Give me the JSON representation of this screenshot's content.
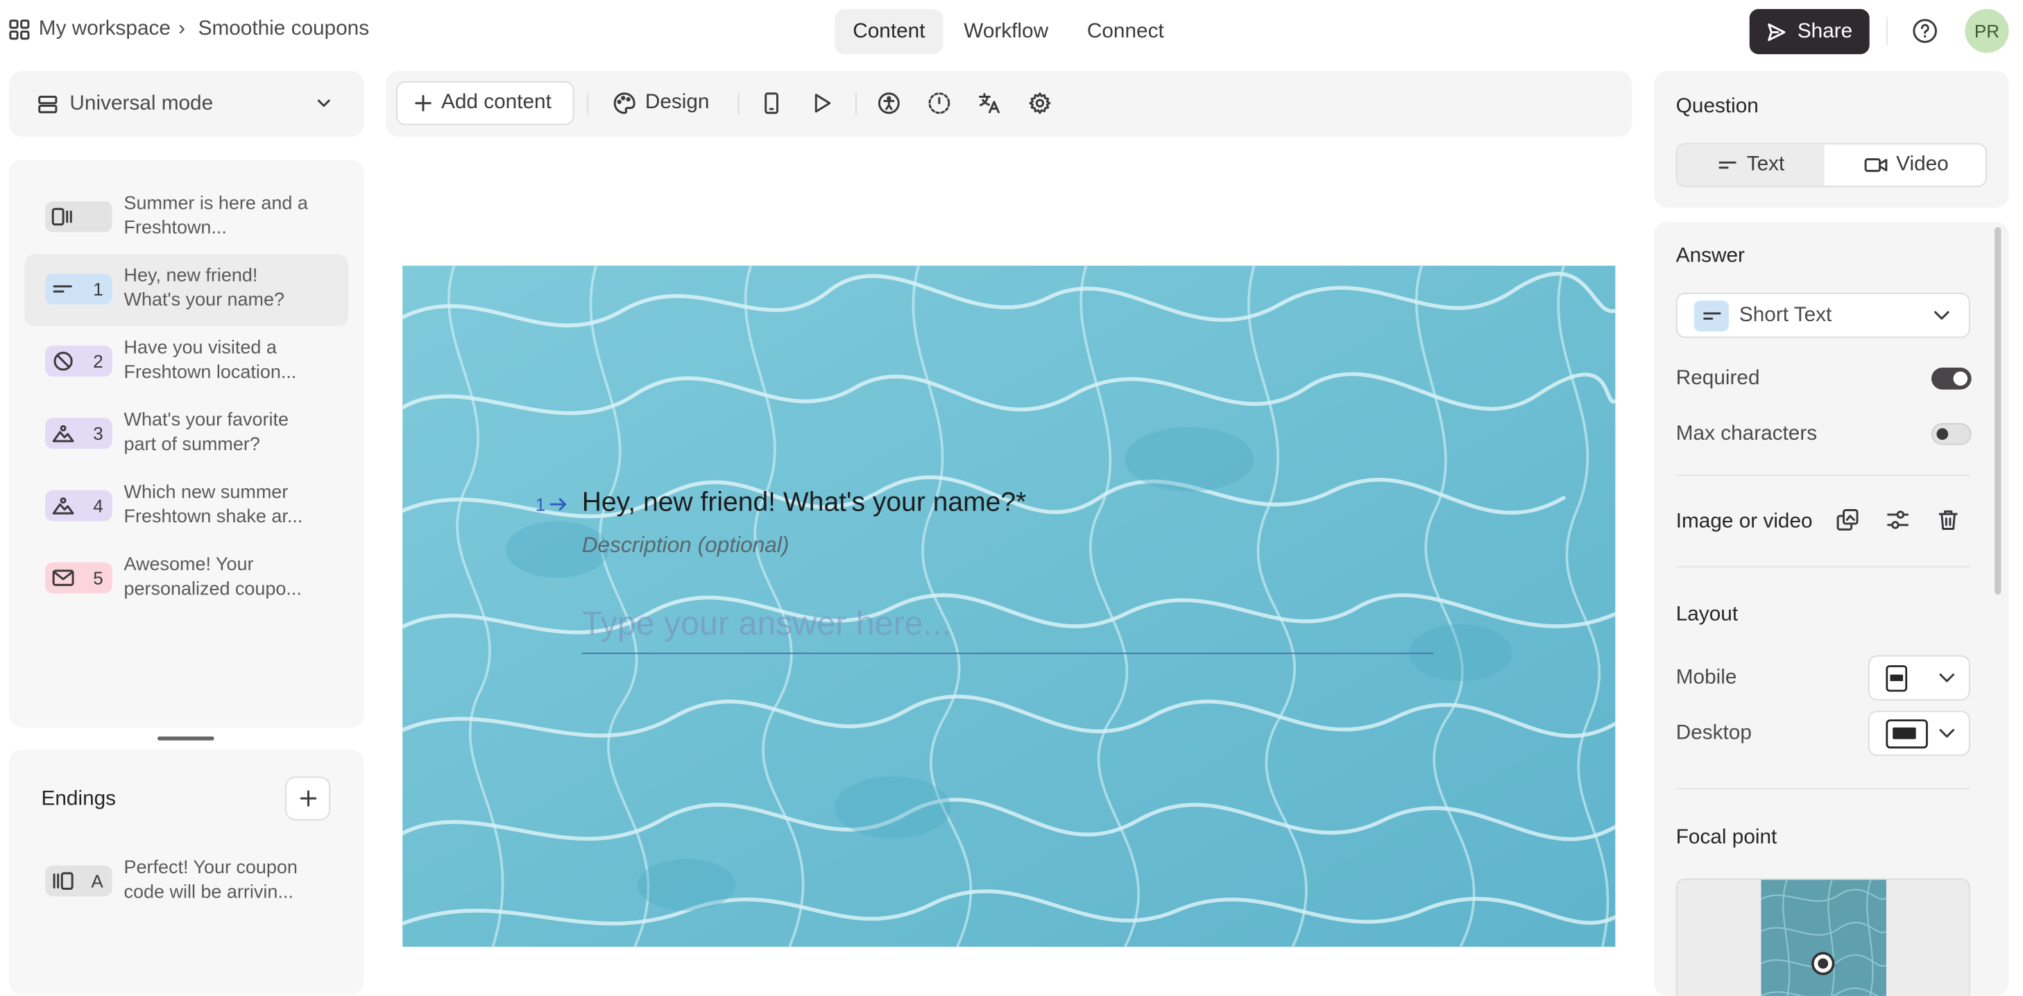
{
  "header": {
    "workspace": "My workspace",
    "separator": "›",
    "project": "Smoothie coupons",
    "tabs": [
      "Content",
      "Workflow",
      "Connect"
    ],
    "share_label": "Share",
    "avatar_initials": "PR"
  },
  "mode_selector": {
    "label": "Universal mode"
  },
  "questions": [
    {
      "num": "",
      "icon": "statement-icon",
      "color": "#e3e3e3",
      "text": "Summer is here and a Freshtown..."
    },
    {
      "num": "1",
      "icon": "short-text-icon",
      "color": "#cfe3f7",
      "text": "Hey, new friend! What's your name?"
    },
    {
      "num": "2",
      "icon": "yes-no-icon",
      "color": "#e3daf5",
      "text": "Have you visited a Freshtown location..."
    },
    {
      "num": "3",
      "icon": "picture-choice-icon",
      "color": "#e3daf5",
      "text": "What's your favorite part of summer?"
    },
    {
      "num": "4",
      "icon": "picture-choice-icon",
      "color": "#e3daf5",
      "text": "Which new summer Freshtown shake ar..."
    },
    {
      "num": "5",
      "icon": "email-icon",
      "color": "#fbd4dc",
      "text": "Awesome! Your personalized coupo..."
    }
  ],
  "endings": {
    "title": "Endings",
    "items": [
      {
        "num": "A",
        "icon": "ending-icon",
        "color": "#e3e3e3",
        "text": "Perfect! Your coupon code will be arrivin..."
      }
    ]
  },
  "toolbar": {
    "add_content": "Add content",
    "design": "Design"
  },
  "canvas": {
    "question_number": "1",
    "question_title": "Hey, new friend! What's your name?*",
    "description_placeholder": "Description (optional)",
    "answer_placeholder": "Type your answer here..."
  },
  "right_panel": {
    "question_heading": "Question",
    "segment_text": "Text",
    "segment_video": "Video",
    "answer_heading": "Answer",
    "answer_type": "Short Text",
    "required_label": "Required",
    "required_on": true,
    "max_chars_label": "Max characters",
    "max_chars_on": false,
    "image_video_label": "Image or video",
    "layout_heading": "Layout",
    "mobile_label": "Mobile",
    "desktop_label": "Desktop",
    "focal_heading": "Focal point"
  }
}
